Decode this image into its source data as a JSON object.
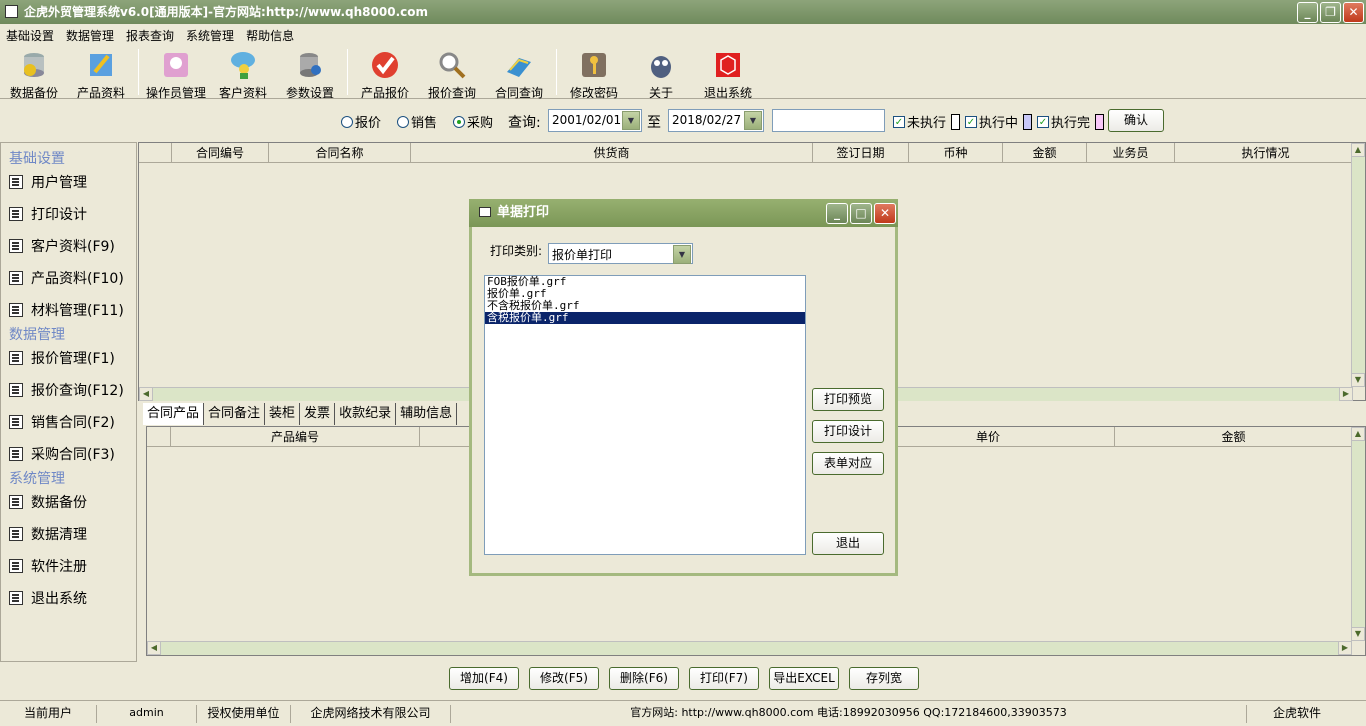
{
  "window": {
    "title": "企虎外贸管理系统v6.0[通用版本]-官方网站:http://www.qh8000.com"
  },
  "menu": [
    "基础设置",
    "数据管理",
    "报表查询",
    "系统管理",
    "帮助信息"
  ],
  "toolbar": [
    {
      "label": "数据备份",
      "icon": "database-icon"
    },
    {
      "label": "产品资料",
      "icon": "product-icon"
    },
    {
      "label": "操作员管理",
      "icon": "operator-icon"
    },
    {
      "label": "客户资料",
      "icon": "customer-icon"
    },
    {
      "label": "参数设置",
      "icon": "settings-db-icon"
    },
    {
      "label": "产品报价",
      "icon": "checkmark-icon"
    },
    {
      "label": "报价查询",
      "icon": "magnifier-icon"
    },
    {
      "label": "合同查询",
      "icon": "book-icon"
    },
    {
      "label": "修改密码",
      "icon": "key-icon"
    },
    {
      "label": "关于",
      "icon": "mascot-icon"
    },
    {
      "label": "退出系统",
      "icon": "exit-cube-icon"
    }
  ],
  "search": {
    "radios": [
      {
        "label": "报价",
        "checked": false
      },
      {
        "label": "销售",
        "checked": false
      },
      {
        "label": "采购",
        "checked": true
      }
    ],
    "query_label": "查询:",
    "date_from": "2001/02/01",
    "to_label": "至",
    "date_to": "2018/02/27",
    "keyword": "",
    "checks": [
      {
        "label": "未执行",
        "checked": true,
        "color": "#ffffff"
      },
      {
        "label": "执行中",
        "checked": true,
        "color": "#c8c8f8"
      },
      {
        "label": "执行完",
        "checked": true,
        "color": "#f8c8f8"
      }
    ],
    "confirm": "确认"
  },
  "sidebar": {
    "sections": [
      {
        "title": "基础设置",
        "items": [
          "用户管理",
          "打印设计",
          "客户资料(F9)",
          "产品资料(F10)",
          "材料管理(F11)"
        ]
      },
      {
        "title": "数据管理",
        "items": [
          "报价管理(F1)",
          "报价查询(F12)",
          "销售合同(F2)",
          "采购合同(F3)"
        ]
      },
      {
        "title": "系统管理",
        "items": [
          "数据备份",
          "数据清理",
          "软件注册",
          "退出系统"
        ]
      }
    ]
  },
  "top_grid": {
    "columns": [
      "",
      "合同编号",
      "合同名称",
      "供货商",
      "签订日期",
      "币种",
      "金额",
      "业务员",
      "执行情况"
    ]
  },
  "tabs": [
    "合同产品",
    "合同备注",
    "装柜",
    "发票",
    "收款纪录",
    "辅助信息"
  ],
  "bottom_grid": {
    "columns": [
      "",
      "产品编号",
      "",
      "单价",
      "金额"
    ]
  },
  "actions": [
    "增加(F4)",
    "修改(F5)",
    "删除(F6)",
    "打印(F7)",
    "导出EXCEL",
    "存列宽"
  ],
  "status": {
    "user_label": "当前用户",
    "user": "admin",
    "org_label": "授权使用单位",
    "org": "企虎网络技术有限公司",
    "site": "官方网站: http://www.qh8000.com 电话:18992030956 QQ:172184600,33903573",
    "brand": "企虎软件"
  },
  "dialog": {
    "title": "单据打印",
    "type_label": "打印类别:",
    "type_value": "报价单打印",
    "files": [
      "FOB报价单.grf",
      "报价单.grf",
      "不含税报价单.grf",
      "含税报价单.grf"
    ],
    "selected": 3,
    "buttons": [
      "打印预览",
      "打印设计",
      "表单对应",
      "退出"
    ]
  }
}
